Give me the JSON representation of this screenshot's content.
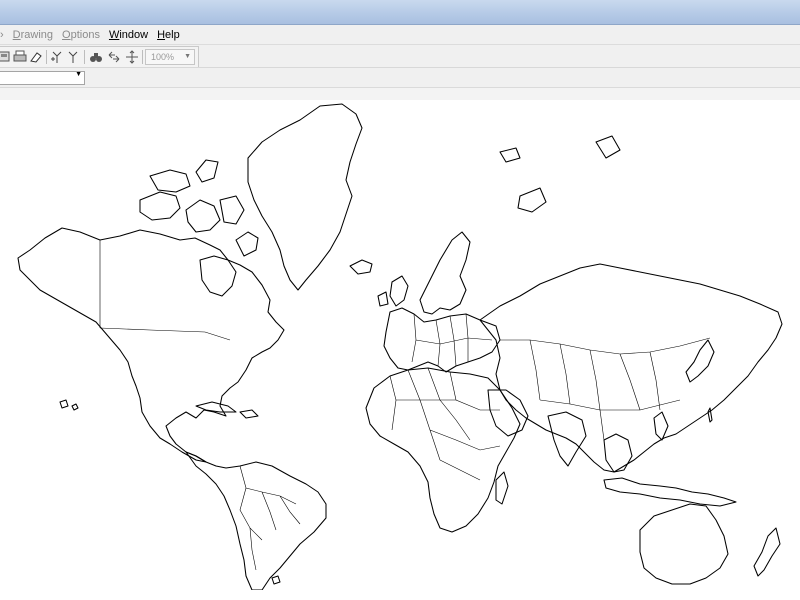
{
  "menubar": {
    "items": [
      {
        "label": "Drawing",
        "underline": "D",
        "rest": "rawing",
        "enabled": false
      },
      {
        "label": "Options",
        "underline": "O",
        "rest": "ptions",
        "enabled": false
      },
      {
        "label": "Window",
        "underline": "W",
        "rest": "indow",
        "enabled": true
      },
      {
        "label": "Help",
        "underline": "H",
        "rest": "elp",
        "enabled": true
      }
    ]
  },
  "toolbar": {
    "zoom_value": "100%",
    "icons": [
      "print-preview-icon",
      "print-icon",
      "eraser-icon",
      "pin-add-icon",
      "pin-icon",
      "binoculars-icon",
      "pan-icon",
      "move-icon"
    ]
  },
  "map": {
    "projection": "mercator",
    "style": "country outlines"
  }
}
